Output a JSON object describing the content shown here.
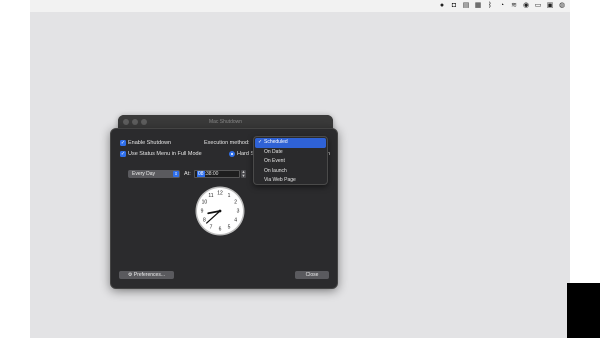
{
  "menubar": {
    "icons": [
      "record-icon",
      "camera-icon",
      "notes-icon",
      "calculator-icon",
      "bluetooth-icon",
      "clock-icon",
      "wifi-icon",
      "user-icon",
      "battery-icon",
      "display-icon",
      "control-center-icon"
    ]
  },
  "back_window": {
    "title": "Mac Shutdown"
  },
  "window": {
    "enable_shutdown_label": "Enable Shutdown",
    "status_menu_label": "Use Status Menu in Full Mode",
    "execution_method_label": "Execution method:",
    "hard_label": "Hard S",
    "overflow_char": "n",
    "schedule_value": "Every Day",
    "at_label": "At:",
    "time_hour": "08",
    "time_rest": ":38:00",
    "preferences_label": "Preferences...",
    "close_label": "Close",
    "clock": {
      "hour": 8,
      "minute": 38
    }
  },
  "dropdown": {
    "selected": "Scheduled",
    "options": [
      "Scheduled",
      "On Date",
      "On Event",
      "On launch",
      "Via Web Page"
    ]
  },
  "colors": {
    "accent": "#2f6feb",
    "window_bg": "#2b2b2d",
    "desktop_bg": "#e3e3e5"
  }
}
